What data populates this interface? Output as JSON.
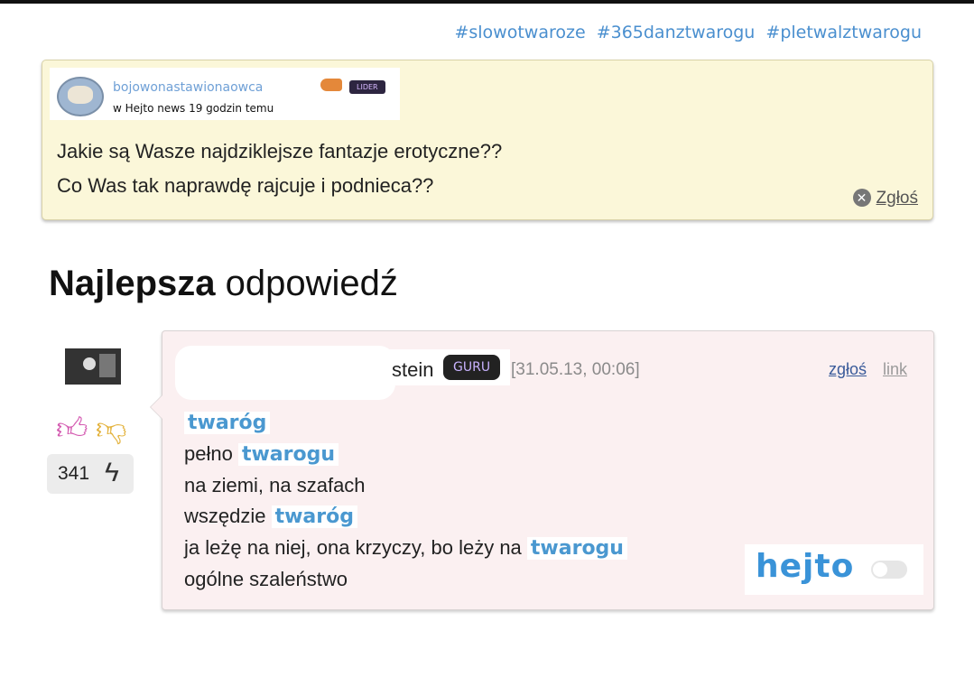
{
  "hashtags": [
    "#slowotwaroze",
    "#365danztwarogu",
    "#pletwalztwarogu"
  ],
  "question": {
    "username": "bojowonastawionaowca",
    "badge": "LIDER",
    "meta": "w Hejto news 19 godzin temu",
    "lines": [
      "Jakie są Wasze najdziklejsze fantazje erotyczne??",
      "Co Was tak naprawdę rajcuje i podnieca??"
    ],
    "report_label": "Zgłoś"
  },
  "best_answer": {
    "bold": "Najlepsza",
    "rest": " odpowiedź"
  },
  "votes": {
    "score": "341"
  },
  "answer": {
    "username_visible": "stein",
    "badge": "GURU",
    "date": "[31.05.13, 00:06]",
    "report_label": "zgłoś",
    "link_label": "link",
    "lines": [
      {
        "pre": "",
        "hl": "twaróg"
      },
      {
        "pre": "pełno ",
        "hl": "twarogu"
      },
      {
        "pre": "na ziemi, na szafach",
        "hl": ""
      },
      {
        "pre": "wszędzie ",
        "hl": "twaróg"
      },
      {
        "pre": "ja leżę na niej, ona krzyczy, bo leży na ",
        "hl": "twarogu"
      },
      {
        "pre": "ogólne szaleństwo",
        "hl": ""
      }
    ]
  },
  "brand": {
    "logo": "hejto",
    "toggle_on": false
  }
}
